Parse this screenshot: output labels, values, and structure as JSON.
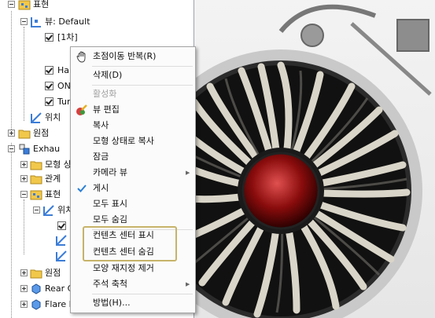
{
  "tree": {
    "items": [
      {
        "label": "표현"
      },
      {
        "label": "뷰: Default"
      },
      {
        "label": "[1차]"
      },
      {
        "label": "Hal"
      },
      {
        "label": "ON"
      },
      {
        "label": "Tur"
      },
      {
        "label": "위치"
      },
      {
        "label": "원점"
      },
      {
        "label": "Exhau"
      },
      {
        "label": "모형 상"
      },
      {
        "label": "관계"
      },
      {
        "label": "표현"
      },
      {
        "label": "위치"
      },
      {
        "label": "원점"
      },
      {
        "label": "Rear C"
      },
      {
        "label": "Flare E"
      }
    ]
  },
  "context_menu": {
    "items": [
      {
        "label": "초점이동 반복(R)",
        "icon": "pan-hand-icon"
      },
      {
        "label": "삭제(D)"
      },
      {
        "label": "활성화",
        "disabled": true
      },
      {
        "label": "뷰 편집",
        "icon": "edit-view-icon"
      },
      {
        "label": "복사"
      },
      {
        "label": "모형 상태로 복사"
      },
      {
        "label": "잠금"
      },
      {
        "label": "카메라 뷰",
        "submenu": true
      },
      {
        "label": "게시",
        "checked": true
      },
      {
        "label": "모두 표시"
      },
      {
        "label": "모두 숨김"
      },
      {
        "label": "컨텐츠 센터 표시",
        "highlighted": true
      },
      {
        "label": "컨텐츠 센터 숨김",
        "highlighted": true
      },
      {
        "label": "모양 재지정 제거"
      },
      {
        "label": "주석 축척",
        "submenu": true
      },
      {
        "label": "방법(H)..."
      }
    ],
    "highlight_color": "#c7b36a",
    "check_color": "#2a7fd4"
  }
}
